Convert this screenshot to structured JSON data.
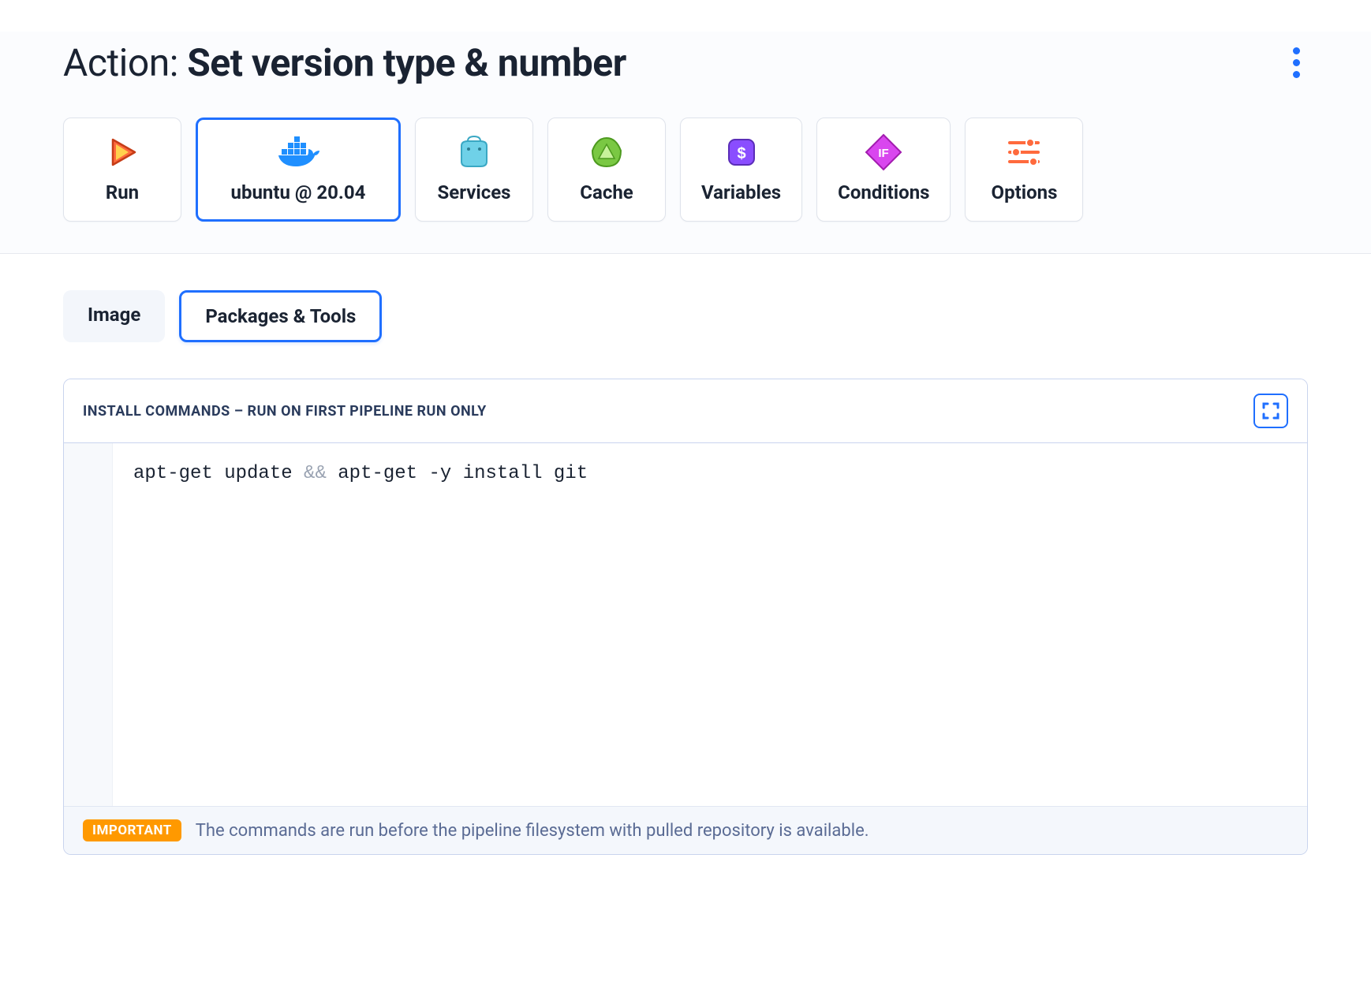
{
  "header": {
    "title_prefix": "Action: ",
    "title_main": "Set version type & number"
  },
  "tabs": [
    {
      "id": "run",
      "label": "Run"
    },
    {
      "id": "env",
      "label": "ubuntu @ 20.04",
      "active": true
    },
    {
      "id": "services",
      "label": "Services"
    },
    {
      "id": "cache",
      "label": "Cache"
    },
    {
      "id": "variables",
      "label": "Variables"
    },
    {
      "id": "conditions",
      "label": "Conditions"
    },
    {
      "id": "options",
      "label": "Options"
    }
  ],
  "subtabs": [
    {
      "id": "image",
      "label": "Image"
    },
    {
      "id": "packages",
      "label": "Packages & Tools",
      "active": true
    }
  ],
  "editor": {
    "header_label": "Install commands – run on first pipeline run only",
    "code_line1_a": "apt-get update ",
    "code_line1_op": "&&",
    "code_line1_b": " apt-get -y install git",
    "footer_badge": "IMPORTANT",
    "footer_text": "The commands are run before the pipeline filesystem with pulled repository is available."
  }
}
